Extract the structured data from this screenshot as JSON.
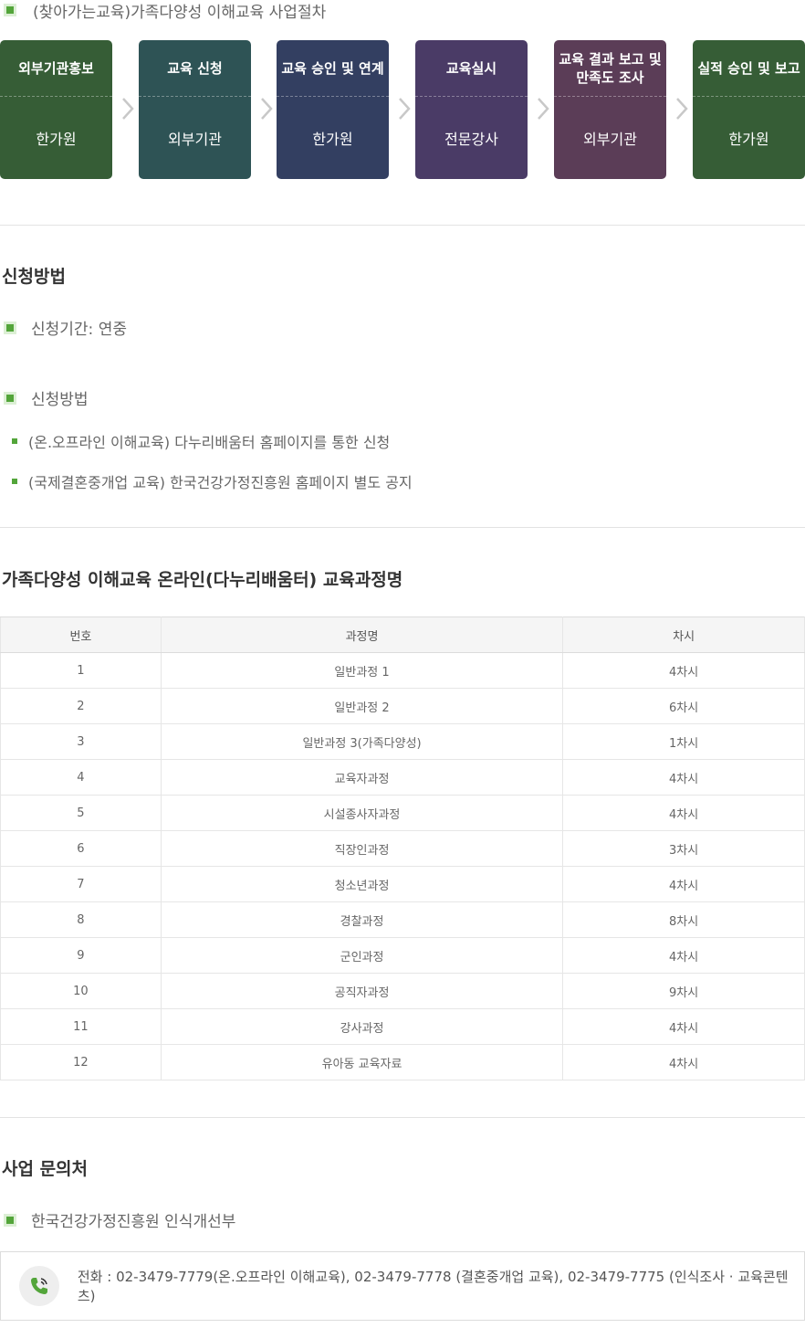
{
  "process": {
    "title": "(찾아가는교육)가족다양성 이해교육 사업절차",
    "steps": [
      {
        "role": "외부기관홍보",
        "actor": "한가원",
        "color": "#365d36"
      },
      {
        "role": "교육 신청",
        "actor": "외부기관",
        "color": "#2e5355"
      },
      {
        "role": "교육 승인 및 연계",
        "actor": "한가원",
        "color": "#333f61"
      },
      {
        "role": "교육실시",
        "actor": "전문강사",
        "color": "#4a3b66"
      },
      {
        "role": "교육 결과 보고 및\n만족도 조사",
        "actor": "외부기관",
        "color": "#5b3d57"
      },
      {
        "role": "실적 승인 및 보고",
        "actor": "한가원",
        "color": "#365d36"
      }
    ]
  },
  "apply": {
    "heading": "신청방법",
    "period": "신청기간: 연중",
    "method_label": "신청방법",
    "methods": [
      "(온.오프라인 이해교육) 다누리배움터 홈페이지를 통한 신청",
      "(국제결혼중개업 교육) 한국건강가정진흥원 홈페이지 별도 공지"
    ]
  },
  "courses": {
    "heading": "가족다양성 이해교육 온라인(다누리배움터) 교육과정명",
    "columns": [
      "번호",
      "과정명",
      "차시"
    ],
    "rows": [
      [
        "1",
        "일반과정 1",
        "4차시"
      ],
      [
        "2",
        "일반과정 2",
        "6차시"
      ],
      [
        "3",
        "일반과정 3(가족다양성)",
        "1차시"
      ],
      [
        "4",
        "교육자과정",
        "4차시"
      ],
      [
        "5",
        "시설종사자과정",
        "4차시"
      ],
      [
        "6",
        "직장인과정",
        "3차시"
      ],
      [
        "7",
        "청소년과정",
        "4차시"
      ],
      [
        "8",
        "경찰과정",
        "8차시"
      ],
      [
        "9",
        "군인과정",
        "4차시"
      ],
      [
        "10",
        "공직자과정",
        "9차시"
      ],
      [
        "11",
        "강사과정",
        "4차시"
      ],
      [
        "12",
        "유아동 교육자료",
        "4차시"
      ]
    ]
  },
  "contact": {
    "heading": "사업 문의처",
    "org": "한국건강가정진흥원 인식개선부",
    "phone": "전화 : 02-3479-7779(온.오프라인 이해교육), 02-3479-7778 (결혼중개업 교육), 02-3479-7775 (인식조사 · 교육콘텐츠)",
    "icon": "phone-icon",
    "accent": "#53a53a"
  }
}
